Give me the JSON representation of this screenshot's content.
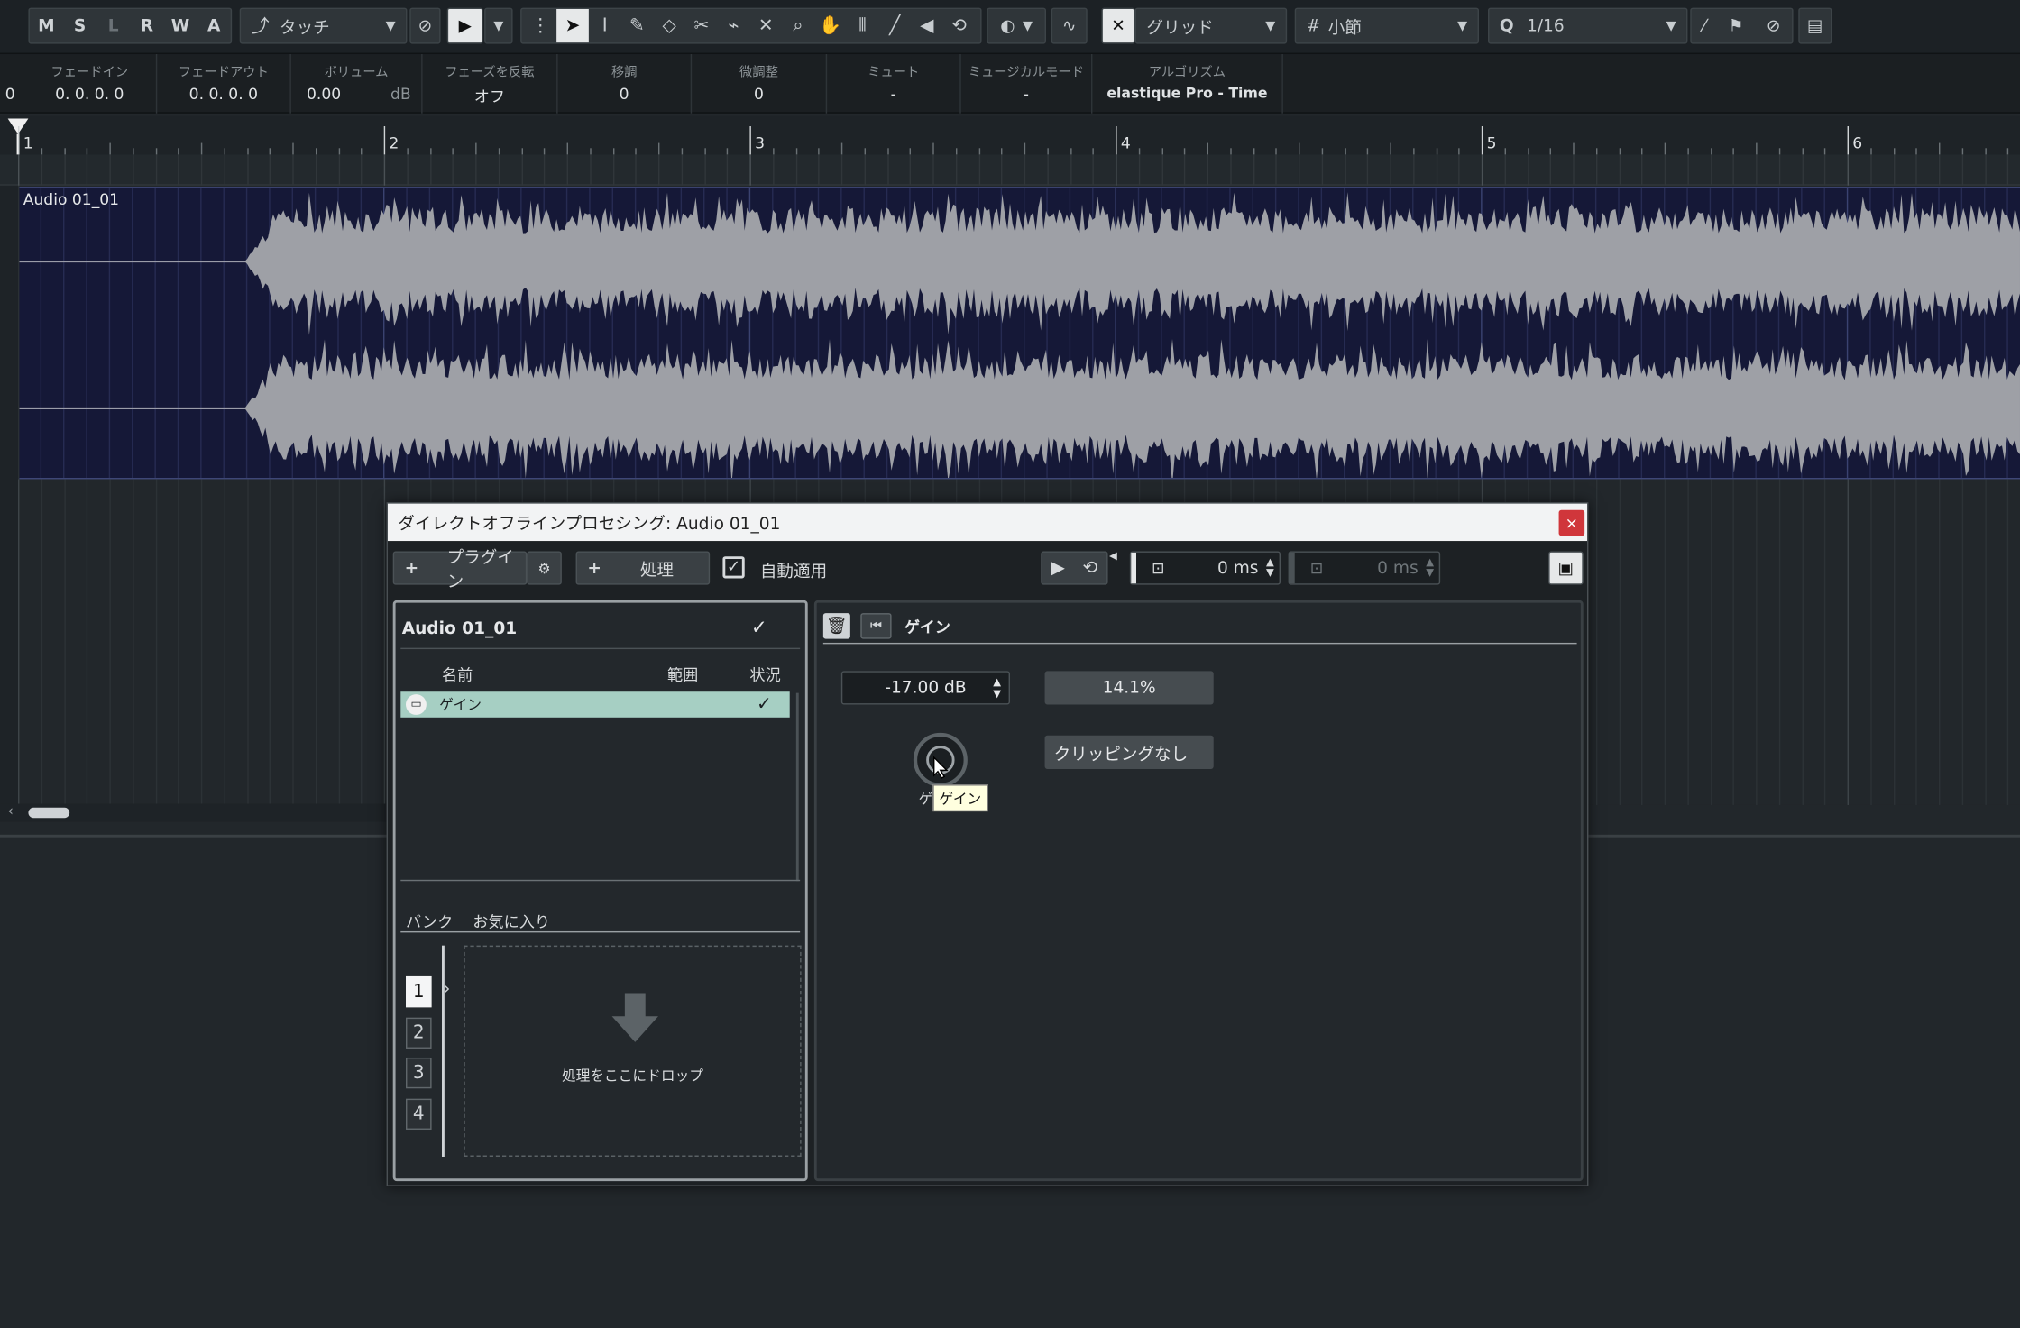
{
  "toolbar": {
    "msl": [
      "M",
      "S",
      "L",
      "R",
      "W",
      "A"
    ],
    "automation_mode": "タッチ",
    "snap_type": "グリッド",
    "grid_type": "小節",
    "quantize_label": "Q",
    "quantize_value": "1/16"
  },
  "infoline": {
    "leading_value": "0",
    "columns": [
      {
        "label": "フェードイン",
        "value": "0.  0.  0.   0"
      },
      {
        "label": "フェードアウト",
        "value": "0.  0.  0.   0"
      },
      {
        "label": "ボリューム",
        "value": "0.00",
        "unit": "dB"
      },
      {
        "label": "フェーズを反転",
        "value": "オフ"
      },
      {
        "label": "移調",
        "value": "0"
      },
      {
        "label": "微調整",
        "value": "0"
      },
      {
        "label": "ミュート",
        "value": "-"
      },
      {
        "label": "ミュージカルモード",
        "value": "-"
      },
      {
        "label": "アルゴリズム",
        "value": "elastique Pro - Time"
      }
    ]
  },
  "ruler": {
    "bars": [
      "1",
      "2",
      "3",
      "4",
      "5",
      "6"
    ]
  },
  "event": {
    "name": "Audio 01_01"
  },
  "dialog": {
    "title": "ダイレクトオフラインプロセシング: Audio 01_01",
    "close": "×",
    "plugin_btn": "プラグイン",
    "process_btn": "処理",
    "plus": "+",
    "auto_apply_label": "自動適用",
    "auto_apply_checked": "✓",
    "pre_roll": "0 ms",
    "post_roll": "0 ms",
    "left_panel": {
      "clip_name": "Audio 01_01",
      "clip_check": "✓",
      "col_name": "名前",
      "col_range": "範囲",
      "col_status": "状況",
      "rows": [
        {
          "name": "ゲイン",
          "status": "✓"
        }
      ],
      "tabs": {
        "bank": "バンク",
        "favorites": "お気に入り"
      },
      "banks": [
        "1",
        "2",
        "3",
        "4"
      ],
      "dropzone_text": "処理をここにドロップ"
    },
    "right_panel": {
      "process_name": "ゲイン",
      "gain_value": "-17.00 dB",
      "percent": "14.1%",
      "clipping": "クリッピングなし",
      "knob_label_partial": "ゲ",
      "tooltip": "ゲイン"
    }
  }
}
